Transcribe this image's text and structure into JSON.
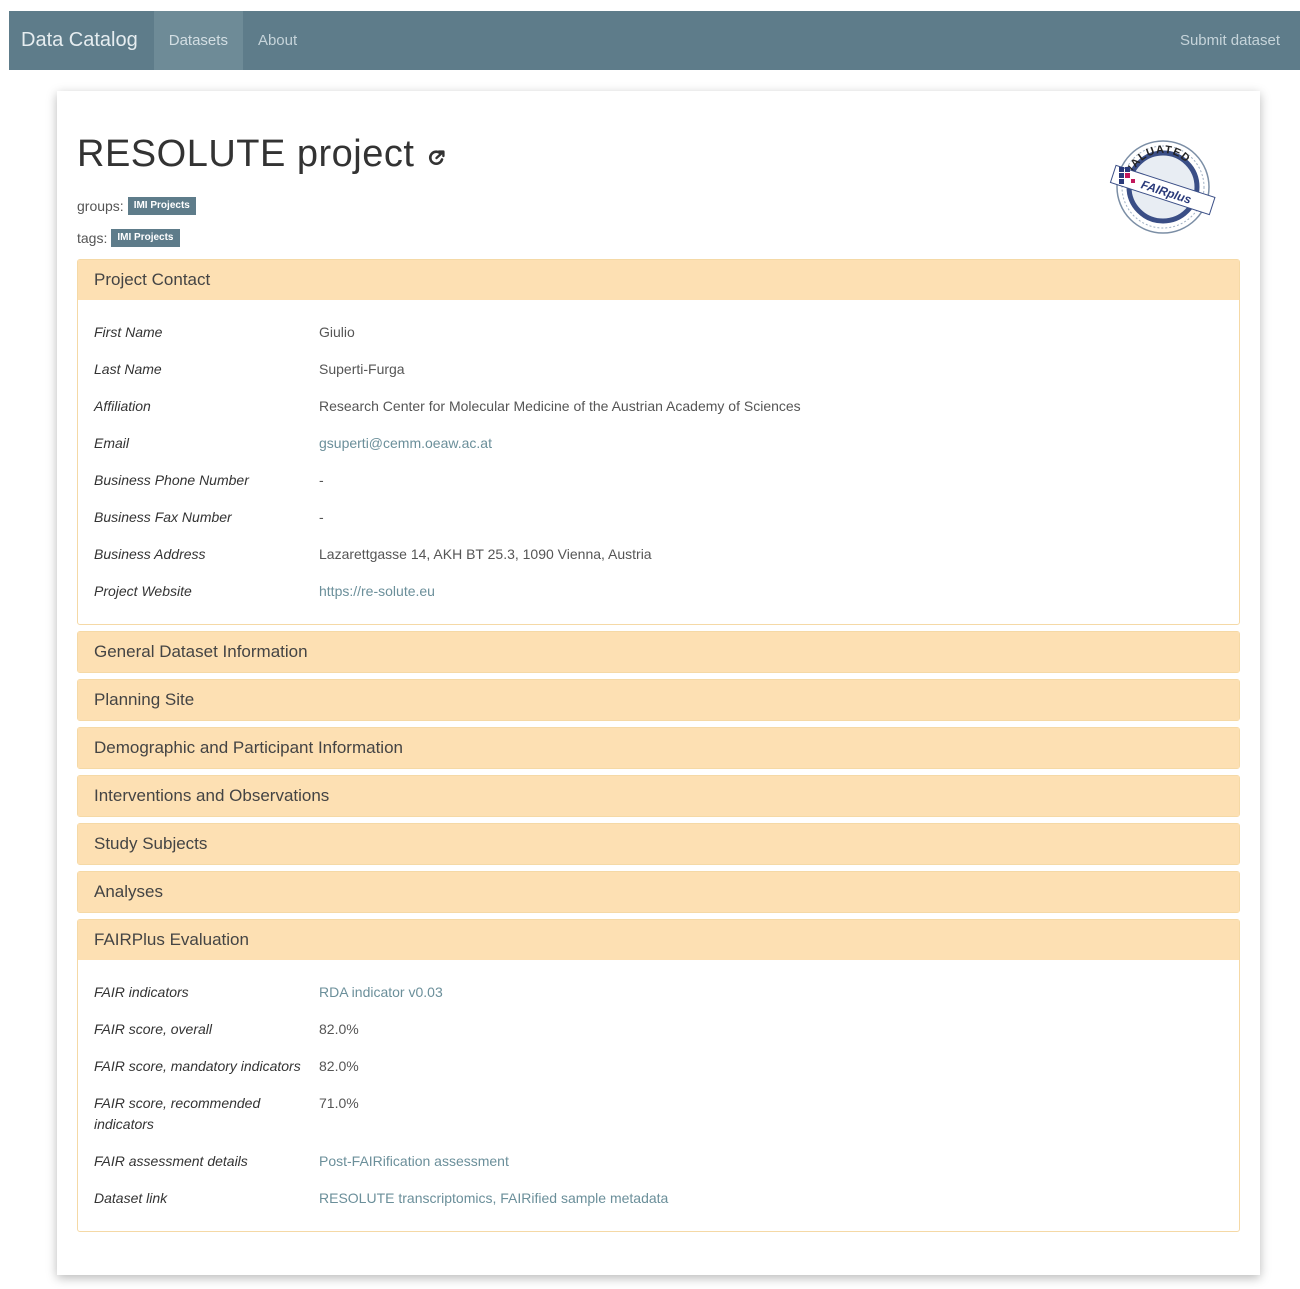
{
  "nav": {
    "brand": "Data Catalog",
    "items": [
      "Datasets",
      "About"
    ],
    "right": "Submit dataset"
  },
  "project": {
    "title": "RESOLUTE project",
    "groups_label": "groups:",
    "groups": [
      "IMI Projects"
    ],
    "tags_label": "tags:",
    "tags": [
      "IMI Projects"
    ]
  },
  "badge": {
    "top_text": "EVALUATED",
    "brand_text": "FAIRplus"
  },
  "colors": {
    "navbar": "#5e7c8a",
    "panel_heading": "#fde0b3",
    "link": "#6b8f9a"
  },
  "contact": {
    "heading": "Project Contact",
    "rows": [
      {
        "key": "First Name",
        "value": "Giulio"
      },
      {
        "key": "Last Name",
        "value": "Superti-Furga"
      },
      {
        "key": "Affiliation",
        "value": "Research Center for Molecular Medicine of the Austrian Academy of Sciences"
      },
      {
        "key": "Email",
        "value": "gsuperti@cemm.oeaw.ac.at"
      },
      {
        "key": "Business Phone Number",
        "value": "-"
      },
      {
        "key": "Business Fax Number",
        "value": "-"
      },
      {
        "key": "Business Address",
        "value": "Lazarettgasse 14, AKH BT 25.3, 1090 Vienna, Austria"
      },
      {
        "key": "Project Website",
        "value": "https://re-solute.eu"
      }
    ]
  },
  "sections": [
    "General Dataset Information",
    "Planning Site",
    "Demographic and Participant Information",
    "Interventions and Observations",
    "Study Subjects",
    "Analyses"
  ],
  "fair": {
    "heading": "FAIRPlus Evaluation",
    "rows": [
      {
        "key": "FAIR indicators",
        "value": "RDA indicator v0.03"
      },
      {
        "key": "FAIR score, overall",
        "value": "82.0%"
      },
      {
        "key": "FAIR score, mandatory indicators",
        "value": "82.0%"
      },
      {
        "key": "FAIR score, recommended indicators",
        "value": "71.0%"
      },
      {
        "key": "FAIR assessment details",
        "value": "Post-FAIRification assessment"
      },
      {
        "key": "Dataset link",
        "value": "RESOLUTE transcriptomics, FAIRified sample metadata"
      }
    ]
  }
}
